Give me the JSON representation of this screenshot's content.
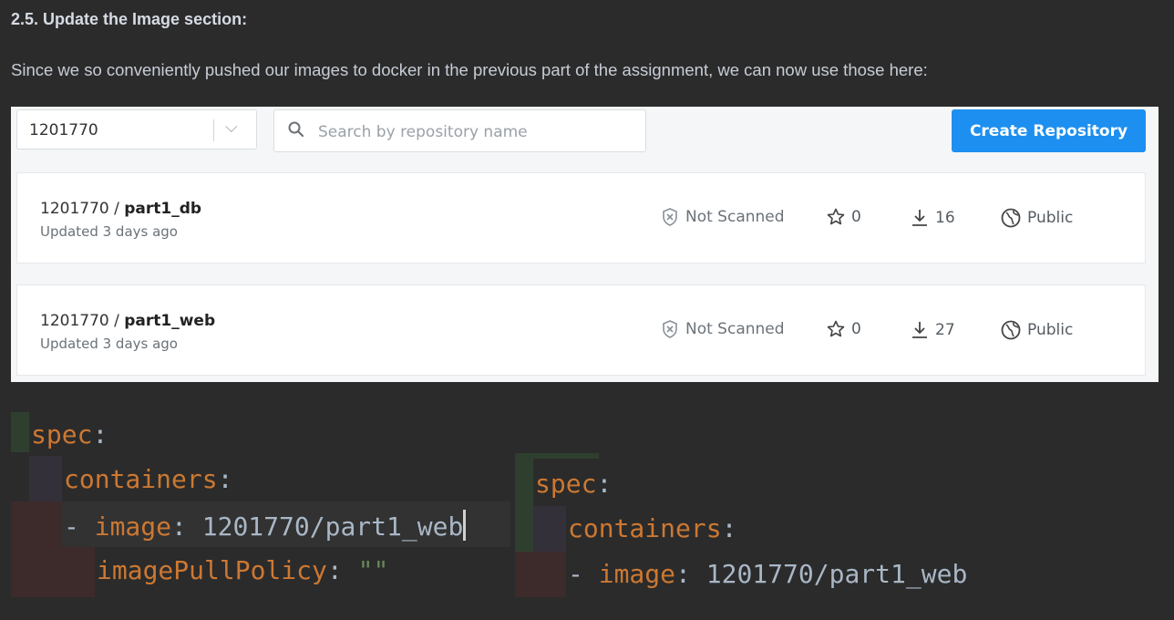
{
  "heading": "2.5. Update the Image section:",
  "intro": "Since we so conveniently pushed our images to docker in the previous part of the assignment, we can now use those here:",
  "hub": {
    "namespace": "1201770",
    "search_placeholder": "Search by repository name",
    "create_label": "Create Repository",
    "repos": [
      {
        "namespace": "1201770 / ",
        "name": "part1_db",
        "updated": "Updated 3 days ago",
        "scan": "Not Scanned",
        "stars": "0",
        "pulls": "16",
        "visibility": "Public"
      },
      {
        "namespace": "1201770 / ",
        "name": "part1_web",
        "updated": "Updated 3 days ago",
        "scan": "Not Scanned",
        "stars": "0",
        "pulls": "27",
        "visibility": "Public"
      }
    ]
  },
  "code_left": {
    "spec": "spec",
    "containers": "containers",
    "dash": "- ",
    "image_key": "image",
    "image_val": "1201770/part1_web",
    "pull_key": "imagePullPolicy",
    "pull_val": "\"\""
  },
  "code_right": {
    "spec": "spec",
    "containers": "containers",
    "dash": "- ",
    "image_key": "image",
    "image_val": "1201770/part1_web"
  },
  "colors": {
    "accent": "#1d8ff0",
    "keyword": "#cc7832",
    "text": "#a9b7c6",
    "string": "#6a8759"
  }
}
